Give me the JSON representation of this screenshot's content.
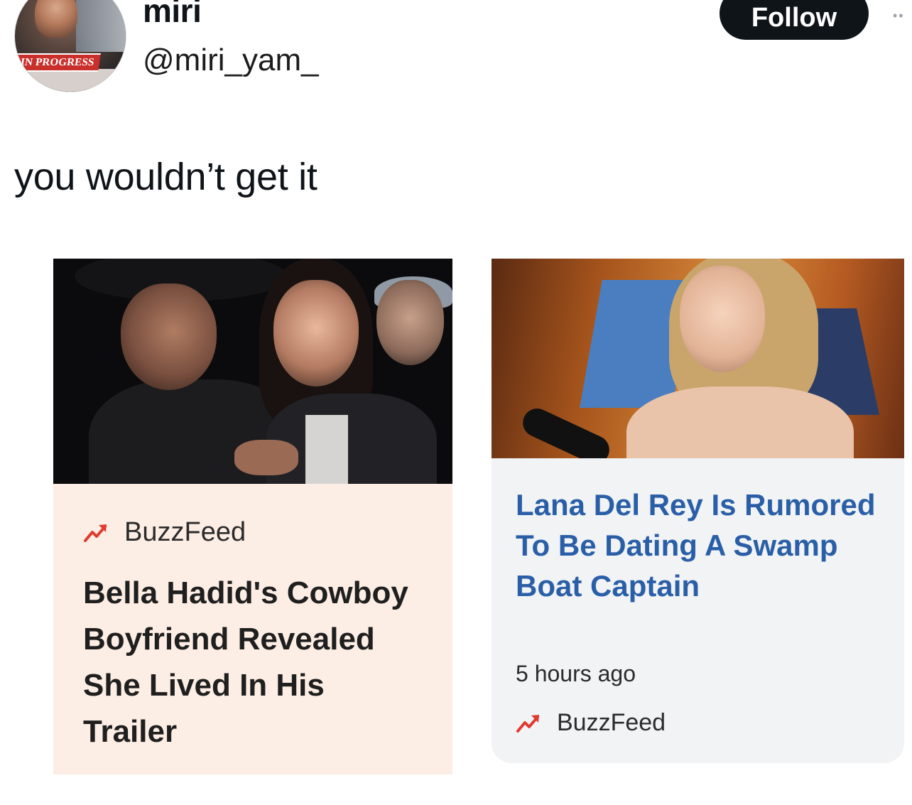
{
  "profile": {
    "avatar_banner": "IN PROGRESS",
    "display_name": "miri",
    "handle": "@miri_yam_",
    "follow_label": "Follow"
  },
  "tweet": {
    "text": "you wouldn’t get it"
  },
  "cards": [
    {
      "source": "BuzzFeed",
      "headline": "Bella Hadid's Cowboy Boyfriend Revealed She Lived In His Trailer",
      "background": "#fdeee5"
    },
    {
      "source": "BuzzFeed",
      "headline": "Lana Del Rey Is Rumored To Be Dating A Swamp Boat Captain",
      "timestamp": "5 hours ago",
      "headline_color": "#2a5fa8",
      "background": "#f1f3f5"
    }
  ],
  "icons": {
    "source_icon": "buzzfeed-trending-arrow-icon",
    "source_icon_color": "#e03a2f"
  }
}
